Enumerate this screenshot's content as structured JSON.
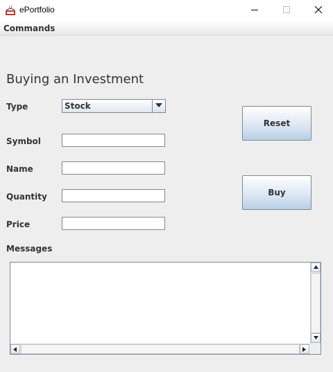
{
  "window": {
    "title": "ePortfolio",
    "icon": "java-app-icon",
    "controls": [
      "minimize-icon",
      "maximize-icon",
      "close-icon"
    ]
  },
  "menu": {
    "items": [
      {
        "label": "Commands"
      }
    ]
  },
  "form": {
    "heading": "Buying an Investment",
    "type": {
      "label": "Type",
      "value": "Stock",
      "options": [
        "Stock"
      ]
    },
    "symbol": {
      "label": "Symbol",
      "value": ""
    },
    "name": {
      "label": "Name",
      "value": ""
    },
    "quantity": {
      "label": "Quantity",
      "value": ""
    },
    "price": {
      "label": "Price",
      "value": ""
    }
  },
  "buttons": {
    "reset": "Reset",
    "buy": "Buy"
  },
  "messages": {
    "label": "Messages",
    "content": ""
  },
  "colors": {
    "background": "#eeeeee",
    "button_gradient_bottom": "#b8cfe5",
    "border": "#7a8a99"
  }
}
